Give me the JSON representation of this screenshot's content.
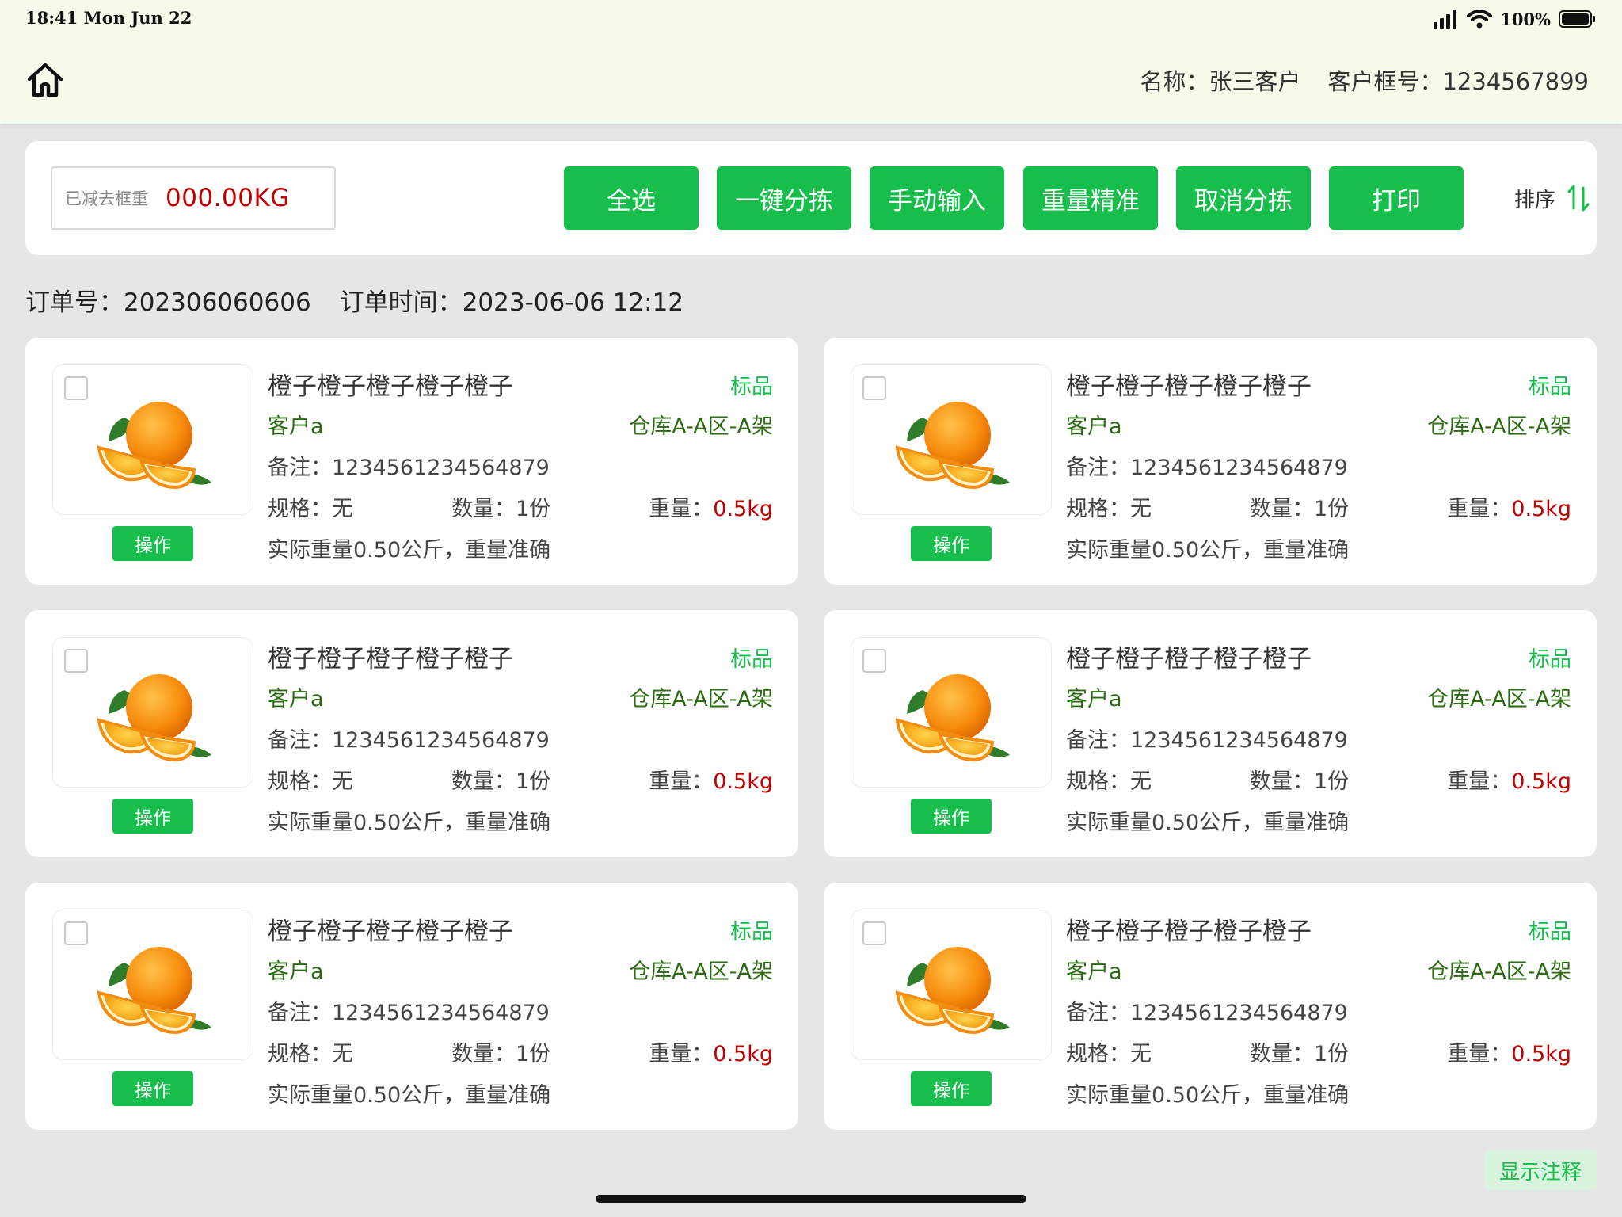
{
  "status_bar": {
    "time": "18:41 Mon Jun 22",
    "battery_percent": "100%"
  },
  "header": {
    "name_label": "名称：",
    "name_value": "张三客户",
    "box_no_label": "客户框号：",
    "box_no_value": "1234567899"
  },
  "toolbar": {
    "frame_weight_label": "已减去框重",
    "frame_weight_value": "000.00KG",
    "buttons": [
      "全选",
      "一键分拣",
      "手动输入",
      "重量精准",
      "取消分拣",
      "打印"
    ],
    "sort_label": "排序"
  },
  "order": {
    "number_label": "订单号：",
    "number_value": "202306060606",
    "time_label": "订单时间：",
    "time_value": "2023-06-06 12:12"
  },
  "items": [
    {
      "title": "橙子橙子橙子橙子橙子",
      "tag": "标品",
      "customer": "客户a",
      "location": "仓库A-A区-A架",
      "note_label": "备注：",
      "note": "1234561234564879",
      "spec_label": "规格：",
      "spec": "无",
      "qty_label": "数量：",
      "qty": "1份",
      "weight_label": "重量：",
      "weight": "0.5kg",
      "actual": "实际重量0.50公斤，重量准确",
      "op_label": "操作"
    },
    {
      "title": "橙子橙子橙子橙子橙子",
      "tag": "标品",
      "customer": "客户a",
      "location": "仓库A-A区-A架",
      "note_label": "备注：",
      "note": "1234561234564879",
      "spec_label": "规格：",
      "spec": "无",
      "qty_label": "数量：",
      "qty": "1份",
      "weight_label": "重量：",
      "weight": "0.5kg",
      "actual": "实际重量0.50公斤，重量准确",
      "op_label": "操作"
    },
    {
      "title": "橙子橙子橙子橙子橙子",
      "tag": "标品",
      "customer": "客户a",
      "location": "仓库A-A区-A架",
      "note_label": "备注：",
      "note": "1234561234564879",
      "spec_label": "规格：",
      "spec": "无",
      "qty_label": "数量：",
      "qty": "1份",
      "weight_label": "重量：",
      "weight": "0.5kg",
      "actual": "实际重量0.50公斤，重量准确",
      "op_label": "操作"
    },
    {
      "title": "橙子橙子橙子橙子橙子",
      "tag": "标品",
      "customer": "客户a",
      "location": "仓库A-A区-A架",
      "note_label": "备注：",
      "note": "1234561234564879",
      "spec_label": "规格：",
      "spec": "无",
      "qty_label": "数量：",
      "qty": "1份",
      "weight_label": "重量：",
      "weight": "0.5kg",
      "actual": "实际重量0.50公斤，重量准确",
      "op_label": "操作"
    },
    {
      "title": "橙子橙子橙子橙子橙子",
      "tag": "标品",
      "customer": "客户a",
      "location": "仓库A-A区-A架",
      "note_label": "备注：",
      "note": "1234561234564879",
      "spec_label": "规格：",
      "spec": "无",
      "qty_label": "数量：",
      "qty": "1份",
      "weight_label": "重量：",
      "weight": "0.5kg",
      "actual": "实际重量0.50公斤，重量准确",
      "op_label": "操作"
    },
    {
      "title": "橙子橙子橙子橙子橙子",
      "tag": "标品",
      "customer": "客户a",
      "location": "仓库A-A区-A架",
      "note_label": "备注：",
      "note": "1234561234564879",
      "spec_label": "规格：",
      "spec": "无",
      "qty_label": "数量：",
      "qty": "1份",
      "weight_label": "重量：",
      "weight": "0.5kg",
      "actual": "实际重量0.50公斤，重量准确",
      "op_label": "操作"
    }
  ],
  "annotation_button": "显示注释",
  "icons": {
    "home": "home-icon",
    "signal": "signal-icon",
    "wifi": "wifi-icon",
    "battery": "battery-icon",
    "sort": "sort-icon",
    "product": "orange-image"
  },
  "colors": {
    "primary_green": "#18be4c",
    "location_green": "#2d6b13",
    "weight_red": "#c00000",
    "header_bg": "#f4fbea",
    "page_bg": "#e6e6e6"
  }
}
